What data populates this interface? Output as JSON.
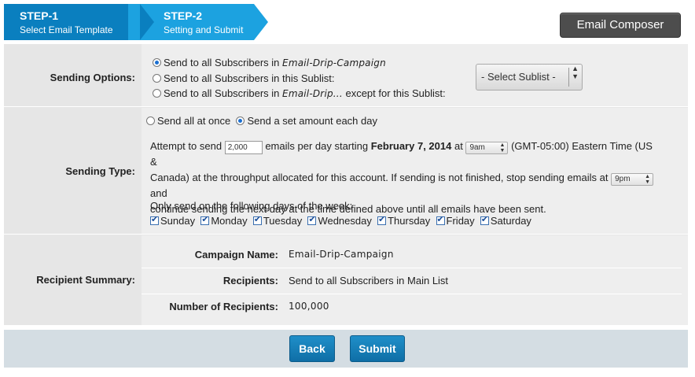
{
  "steps": [
    {
      "title": "STEP-1",
      "subtitle": "Select Email Template"
    },
    {
      "title": "STEP-2",
      "subtitle": "Setting and Submit"
    }
  ],
  "composer_button": "Email Composer",
  "sending_options": {
    "label": "Sending Options:",
    "opt1_prefix": "Send to all Subscribers in",
    "opt1_campaign": "Email-Drip-Campaign",
    "opt2": "Send to all Subscribers in this Sublist:",
    "opt3_prefix": "Send to all Subscribers in",
    "opt3_campaign": "Email-Drip...",
    "opt3_suffix": "except for this Sublist:",
    "sublist_select": "- Select Sublist -"
  },
  "sending_type": {
    "label": "Sending Type:",
    "mode_all": "Send all at once",
    "mode_daily": "Send a set amount each day",
    "p1": "Attempt to send",
    "amount": "2,000",
    "p2": "emails per day starting",
    "date": "February 7, 2014",
    "p3": "at",
    "start_time": "9am",
    "p4": "(GMT-05:00) Eastern Time (US &",
    "p5": "Canada) at the throughput allocated for this account. If sending is not finished, stop sending emails at",
    "stop_time": "9pm",
    "p6": "and",
    "p7": "continue sending the next day at the time defined above until all emails have been sent.",
    "days_label": "Only send on the following days of the week:",
    "days": [
      "Sunday",
      "Monday",
      "Tuesday",
      "Wednesday",
      "Thursday",
      "Friday",
      "Saturday"
    ]
  },
  "summary": {
    "label": "Recipient Summary:",
    "campaign_name_label": "Campaign Name:",
    "campaign_name": "Email-Drip-Campaign",
    "recipients_label": "Recipients:",
    "recipients": "Send to all Subscribers in Main List",
    "count_label": "Number of Recipients:",
    "count": "100,000"
  },
  "footer": {
    "back": "Back",
    "submit": "Submit"
  },
  "colors": {
    "step1": "#0a7fbf",
    "step2": "#1ca2e0",
    "button": "#1179b3",
    "panel": "#e6e6e6"
  }
}
